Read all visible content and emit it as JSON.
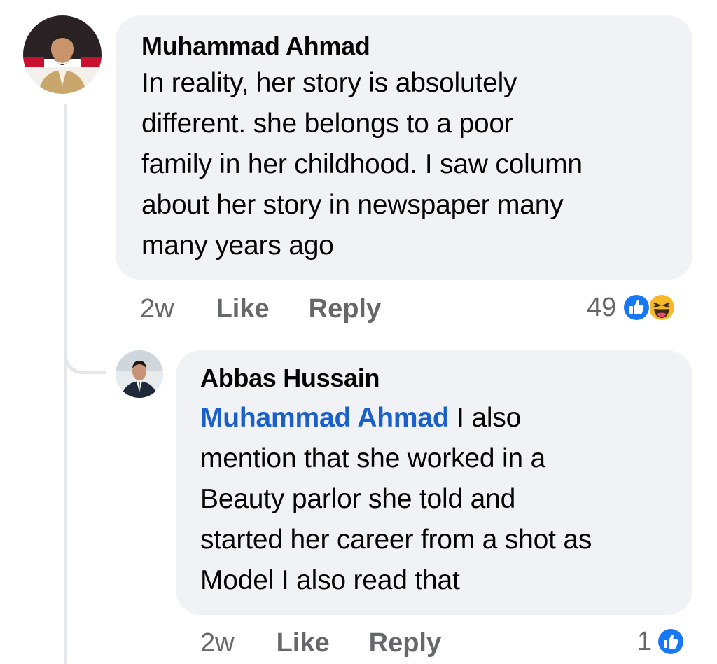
{
  "comments": [
    {
      "author": "Muhammad Ahmad",
      "lines": [
        "In reality, her story is absolutely",
        "different. she belongs to a poor",
        "family in her childhood. I saw column",
        "about her story in newspaper many",
        "many years ago"
      ],
      "time": "2w",
      "like_label": "Like",
      "reply_label": "Reply",
      "reaction_count": "49",
      "reaction_icons": [
        "like-icon",
        "haha-icon"
      ],
      "colors": {
        "like": "#1877f2",
        "haha": "#f7b928"
      }
    },
    {
      "author": "Abbas Hussain",
      "mention": "Muhammad Ahmad",
      "first_line_rest": " I also",
      "lines": [
        "mention that she worked in a",
        "Beauty parlor she told and",
        "started her career from a shot as",
        "Model I also read that"
      ],
      "time": "2w",
      "like_label": "Like",
      "reply_label": "Reply",
      "reaction_count": "1",
      "reaction_icons": [
        "like-icon"
      ]
    }
  ]
}
